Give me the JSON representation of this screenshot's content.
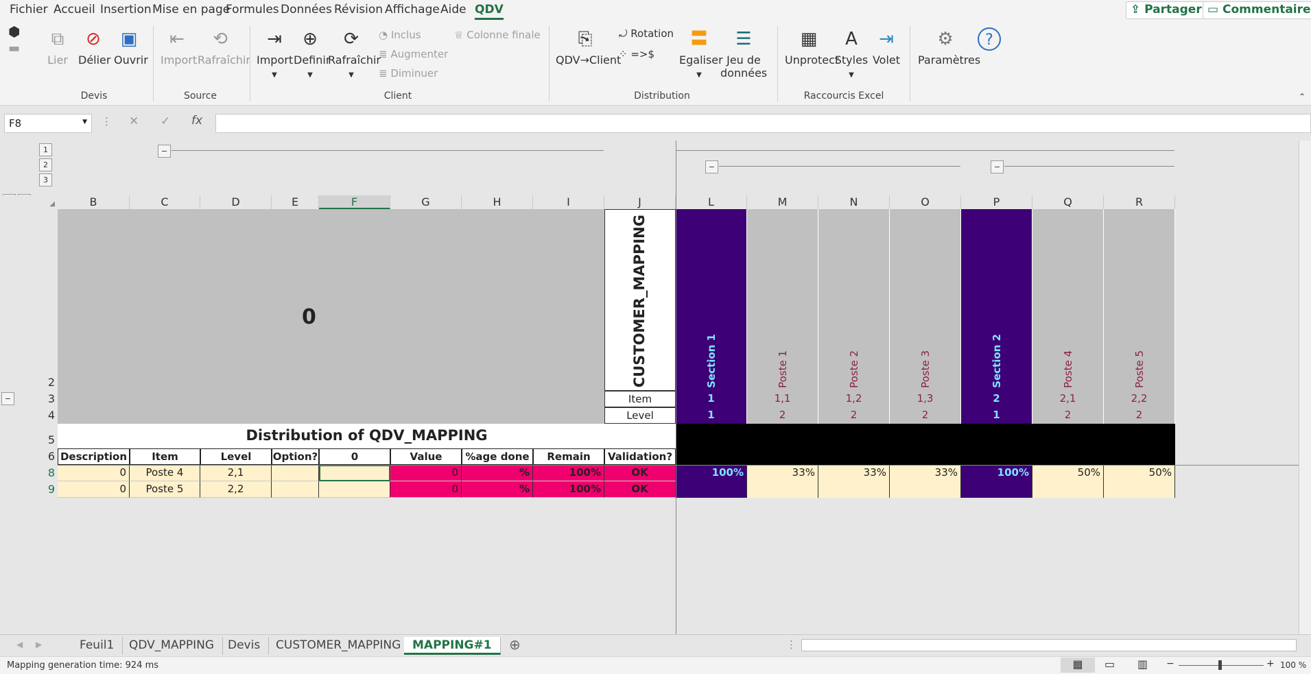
{
  "menu": {
    "items": [
      "Fichier",
      "Accueil",
      "Insertion",
      "Mise en page",
      "Formules",
      "Données",
      "Révision",
      "Affichage",
      "Aide",
      "QDV"
    ],
    "share": "Partager",
    "comments": "Commentaires"
  },
  "ribbon": {
    "devis": {
      "lier": "Lier",
      "delier": "Délier",
      "ouvrir": "Ouvrir",
      "group": "Devis"
    },
    "source": {
      "import": "Import",
      "refresh": "Rafraîchir",
      "group": "Source"
    },
    "client": {
      "import": "Import",
      "definir": "Definir",
      "refresh": "Rafraîchir",
      "inclus": "Inclus",
      "augmenter": "Augmenter",
      "diminuer": "Diminuer",
      "colonne": "Colonne finale",
      "group": "Client"
    },
    "distribution": {
      "qdv_client": "QDV→Client",
      "rotation": "Rotation",
      "arrow": "=>$",
      "egaliser": "Egaliser",
      "jeu1": "Jeu de",
      "jeu2": "données",
      "group": "Distribution"
    },
    "raccourcis": {
      "unprotect": "Unprotect",
      "styles": "Styles",
      "volet": "Volet",
      "group": "Raccourcis Excel"
    },
    "params": {
      "label": "Paramètres",
      "help": "?"
    }
  },
  "formula_bar": {
    "cell_ref": "F8",
    "value": ""
  },
  "outline": {
    "levels": [
      "1",
      "2",
      "3"
    ],
    "top_levels": [
      "1",
      "2"
    ]
  },
  "columns": [
    "B",
    "C",
    "D",
    "E",
    "F",
    "G",
    "H",
    "I",
    "J",
    "L",
    "M",
    "N",
    "O",
    "P",
    "Q",
    "R"
  ],
  "rows": [
    "2",
    "3",
    "4",
    "5",
    "6",
    "8",
    "9"
  ],
  "sheet": {
    "big_value": "0",
    "customer_mapping": "CUSTOMER_MAPPING",
    "item_label": "Item",
    "level_label": "Level",
    "distribution_title": "Distribution of QDV_MAPPING",
    "headers": [
      "Description",
      "Item",
      "Level",
      "Option?",
      "0",
      "Value",
      "%age done",
      "Remain",
      "Validation?"
    ],
    "data_rows": [
      [
        "0",
        "Poste 4",
        "2,1",
        "",
        "",
        "0",
        "%",
        "100%",
        "OK"
      ],
      [
        "0",
        "Poste 5",
        "2,2",
        "",
        "",
        "0",
        "%",
        "100%",
        "OK"
      ]
    ],
    "mapping_cols": [
      {
        "name": "Section 1",
        "item": "1",
        "level": "1",
        "value": "100%",
        "section": true
      },
      {
        "name": "Poste 1",
        "item": "1,1",
        "level": "2",
        "value": "33%",
        "section": false
      },
      {
        "name": "Poste 2",
        "item": "1,2",
        "level": "2",
        "value": "33%",
        "section": false
      },
      {
        "name": "Poste 3",
        "item": "1,3",
        "level": "2",
        "value": "33%",
        "section": false
      },
      {
        "name": "Section 2",
        "item": "2",
        "level": "1",
        "value": "100%",
        "section": true
      },
      {
        "name": "Poste 4",
        "item": "2,1",
        "level": "2",
        "value": "50%",
        "section": false
      },
      {
        "name": "Poste 5",
        "item": "2,2",
        "level": "2",
        "value": "50%",
        "section": false
      }
    ]
  },
  "tabs": [
    "Feuil1",
    "QDV_MAPPING",
    "Devis",
    "CUSTOMER_MAPPING",
    "MAPPING#1"
  ],
  "active_tab": "MAPPING#1",
  "status": {
    "text": "Mapping generation time: 924 ms",
    "zoom": "100 %"
  },
  "colors": {
    "accent": "#217346",
    "section": "#3d0077",
    "pink": "#f0006e",
    "cream": "#fff1cc",
    "grey": "#c0c0c0",
    "cyan": "#7fe3ff",
    "poste_text": "#8b1e4a"
  }
}
